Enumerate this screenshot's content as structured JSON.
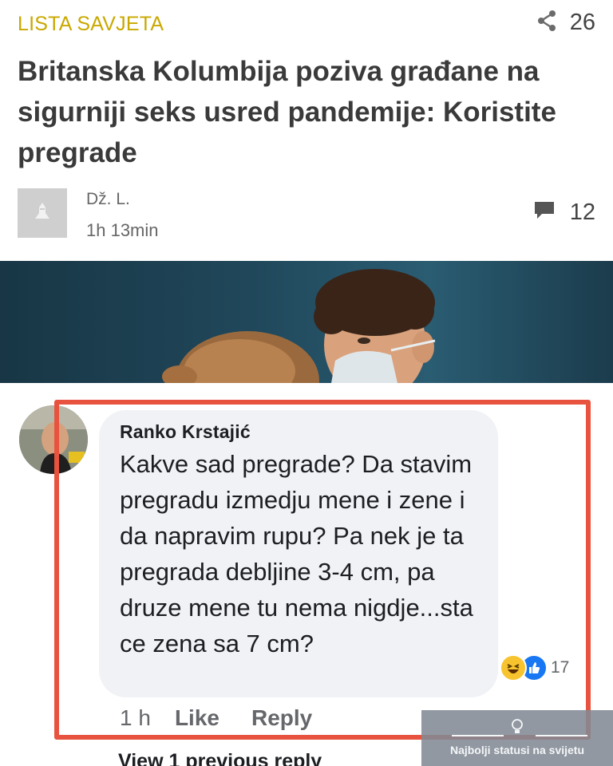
{
  "article": {
    "category": "LISTA SAVJETA",
    "share_count": "26",
    "headline": "Britanska Kolumbija poziva građane na sigurniji seks usred pandemije: Koristite pregrade",
    "author": "Dž. L.",
    "time": "1h 13min",
    "comment_count": "12"
  },
  "comment": {
    "author": "Ranko Krstajić",
    "text": "Kakve sad pregrade? Da stavim pregradu izmedju mene i zene i da napravim rupu? Pa nek je ta pregrada debljine 3-4 cm, pa druze mene tu nema nigdje...sta ce zena sa 7 cm?",
    "reaction_count": "17",
    "time": "1 h",
    "like_label": "Like",
    "reply_label": "Reply",
    "view_previous": "View 1 previous reply"
  },
  "watermark": {
    "text": "Najbolji statusi na svijetu"
  },
  "icons": {
    "share": "share-icon",
    "comment": "comment-icon",
    "placeholder": "user-placeholder-icon",
    "haha": "haha-reaction-icon",
    "like": "like-reaction-icon",
    "bulb": "lightbulb-icon"
  },
  "colors": {
    "category": "#c9a800",
    "highlight": "#e8533f",
    "bubble": "#f0f2f5",
    "like_blue": "#1877f2"
  }
}
